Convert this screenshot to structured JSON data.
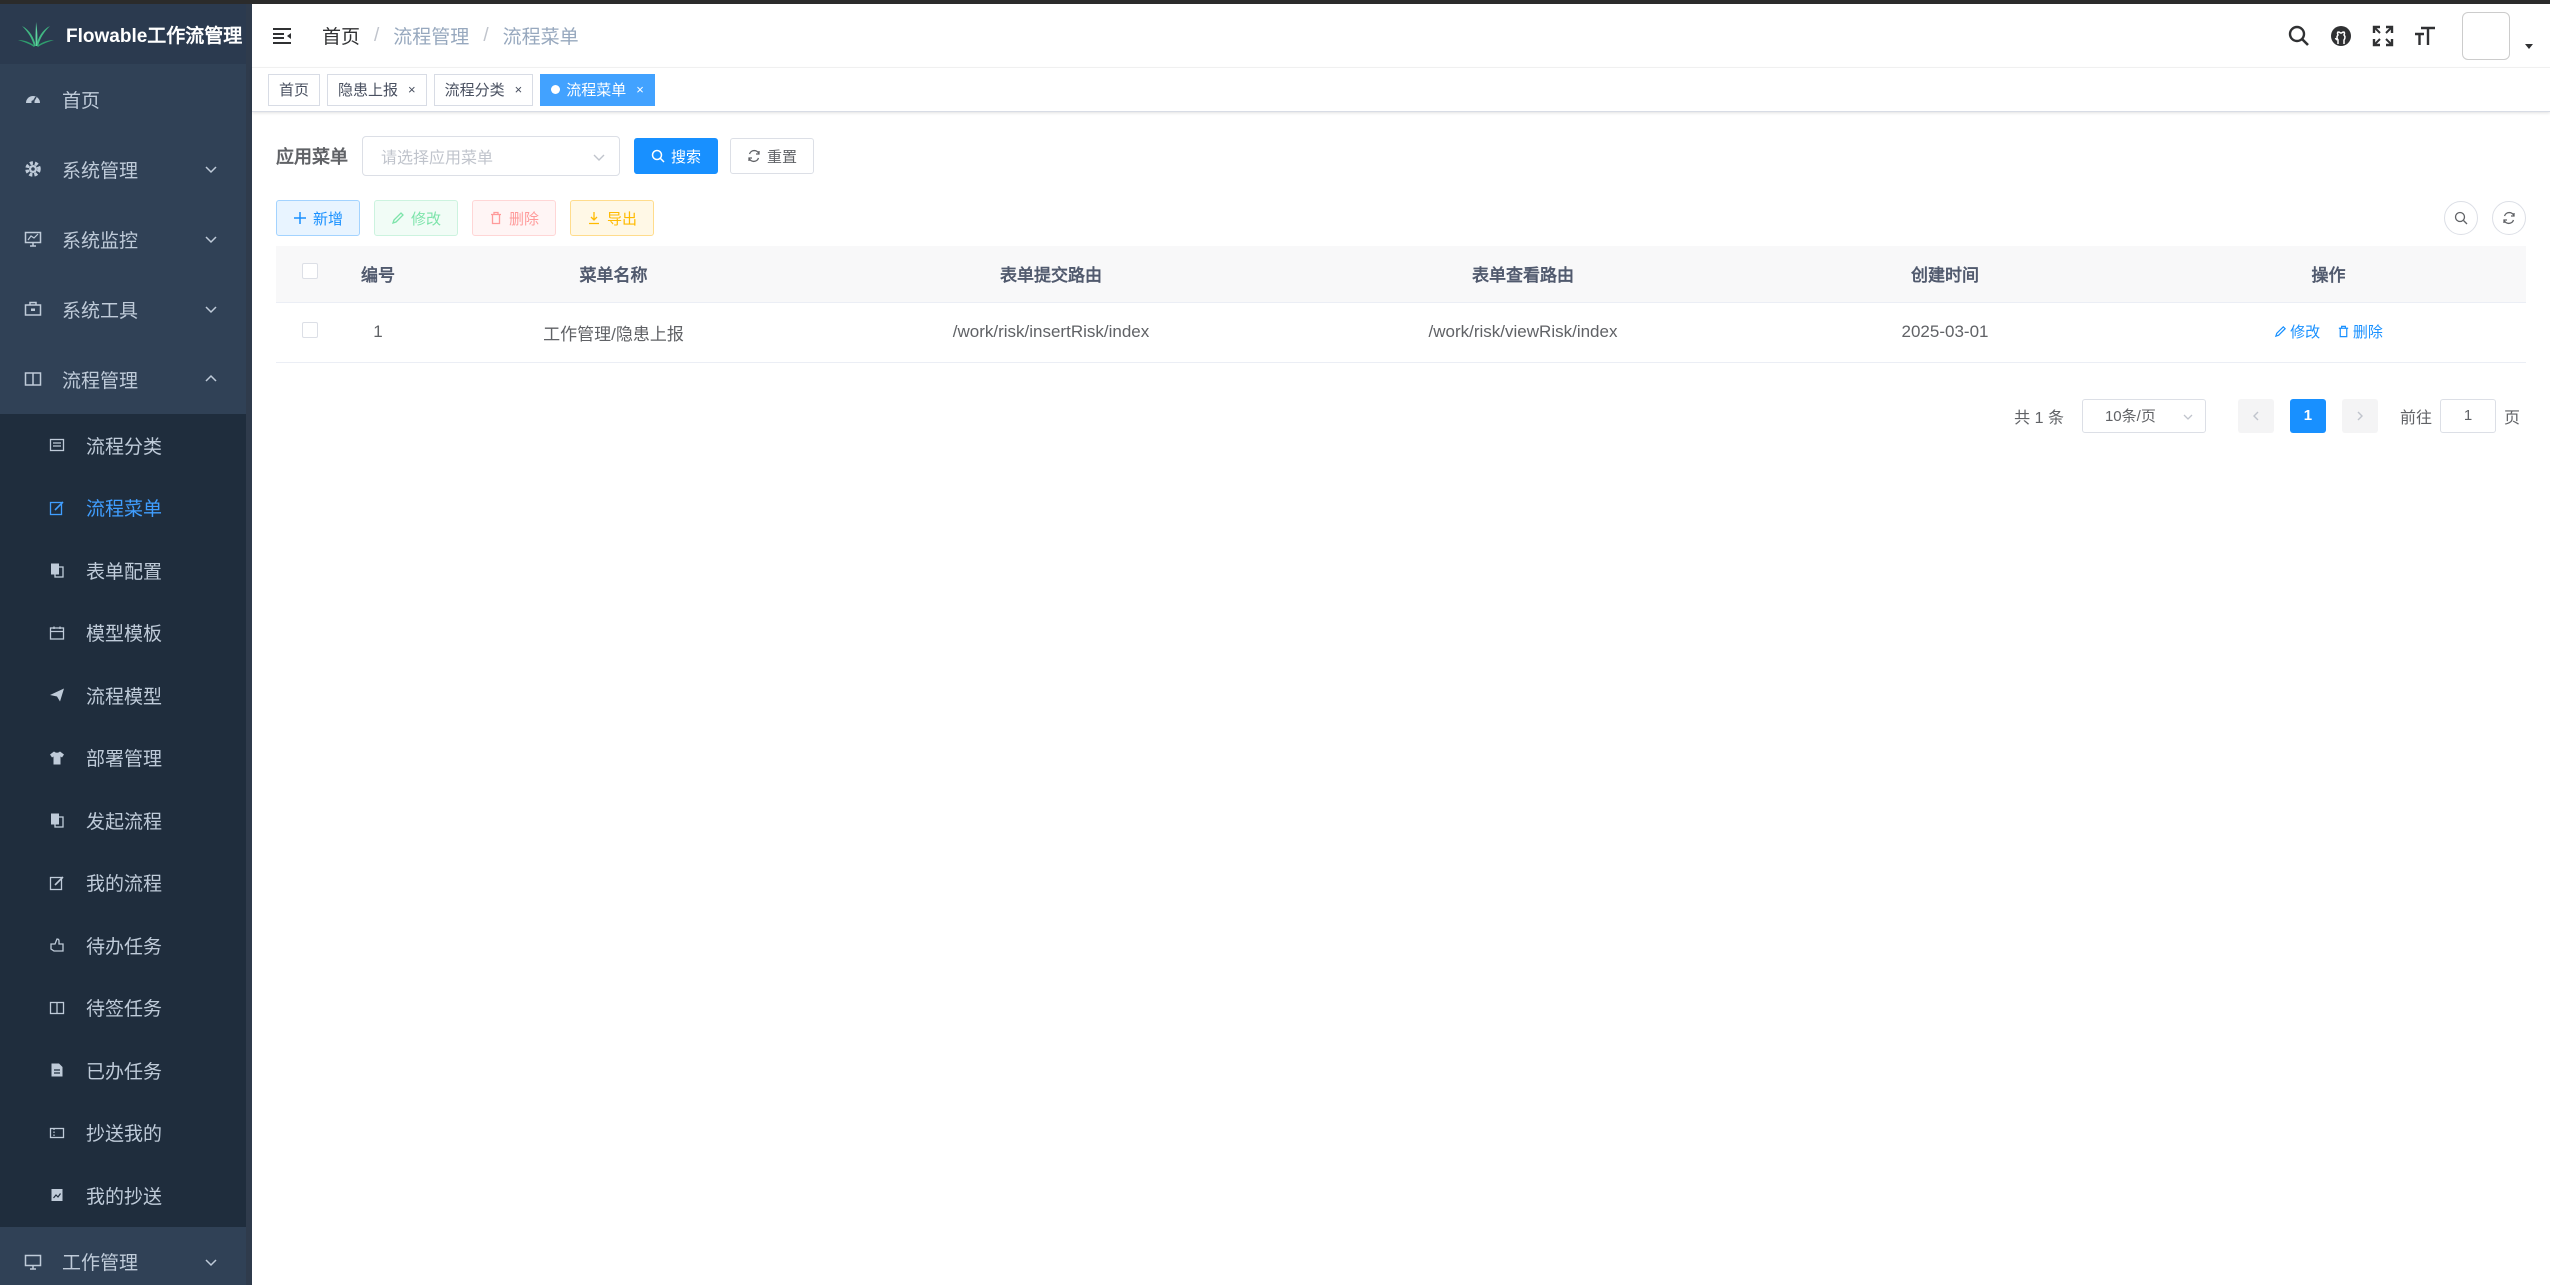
{
  "app": {
    "title": "Flowable工作流管理"
  },
  "sidebar": {
    "items": [
      {
        "label": "首页",
        "icon": "dashboard-icon"
      },
      {
        "label": "系统管理",
        "icon": "gear-icon"
      },
      {
        "label": "系统监控",
        "icon": "monitor-icon"
      },
      {
        "label": "系统工具",
        "icon": "toolbox-icon"
      },
      {
        "label": "流程管理",
        "icon": "book-icon"
      }
    ],
    "submenu": [
      {
        "label": "流程分类",
        "icon": "list-icon"
      },
      {
        "label": "流程菜单",
        "icon": "edit-icon",
        "active": true
      },
      {
        "label": "表单配置",
        "icon": "copy-icon"
      },
      {
        "label": "模型模板",
        "icon": "calendar-icon"
      },
      {
        "label": "流程模型",
        "icon": "send-icon"
      },
      {
        "label": "部署管理",
        "icon": "shirt-icon"
      },
      {
        "label": "发起流程",
        "icon": "copy-icon"
      },
      {
        "label": "我的流程",
        "icon": "edit-icon"
      },
      {
        "label": "待办任务",
        "icon": "hand-icon"
      },
      {
        "label": "待签任务",
        "icon": "book-icon"
      },
      {
        "label": "已办任务",
        "icon": "document-icon"
      },
      {
        "label": "抄送我的",
        "icon": "ticket-icon"
      },
      {
        "label": "我的抄送",
        "icon": "image-icon"
      }
    ],
    "bottom": {
      "label": "工作管理",
      "icon": "monitor-icon"
    }
  },
  "breadcrumb": [
    "首页",
    "流程管理",
    "流程菜单"
  ],
  "tags": [
    {
      "label": "首页",
      "closable": false
    },
    {
      "label": "隐患上报",
      "closable": true
    },
    {
      "label": "流程分类",
      "closable": true
    },
    {
      "label": "流程菜单",
      "closable": true,
      "active": true
    }
  ],
  "search": {
    "label": "应用菜单",
    "placeholder": "请选择应用菜单",
    "search_btn": "搜索",
    "reset_btn": "重置"
  },
  "toolbar": {
    "add": "新增",
    "edit": "修改",
    "delete": "删除",
    "export": "导出"
  },
  "table": {
    "headers": [
      "编号",
      "菜单名称",
      "表单提交路由",
      "表单查看路由",
      "创建时间",
      "操作"
    ],
    "rows": [
      {
        "id": "1",
        "name": "工作管理/隐患上报",
        "submit_route": "/work/risk/insertRisk/index",
        "view_route": "/work/risk/viewRisk/index",
        "created": "2025-03-01",
        "op_edit": "修改",
        "op_delete": "删除"
      }
    ]
  },
  "pagination": {
    "total": "共 1 条",
    "page_size": "10条/页",
    "current": "1",
    "goto_label": "前往",
    "goto_value": "1",
    "page_suffix": "页"
  },
  "colors": {
    "sidebar_bg": "#304156",
    "primary": "#1890ff",
    "active_menu": "#409eff"
  }
}
